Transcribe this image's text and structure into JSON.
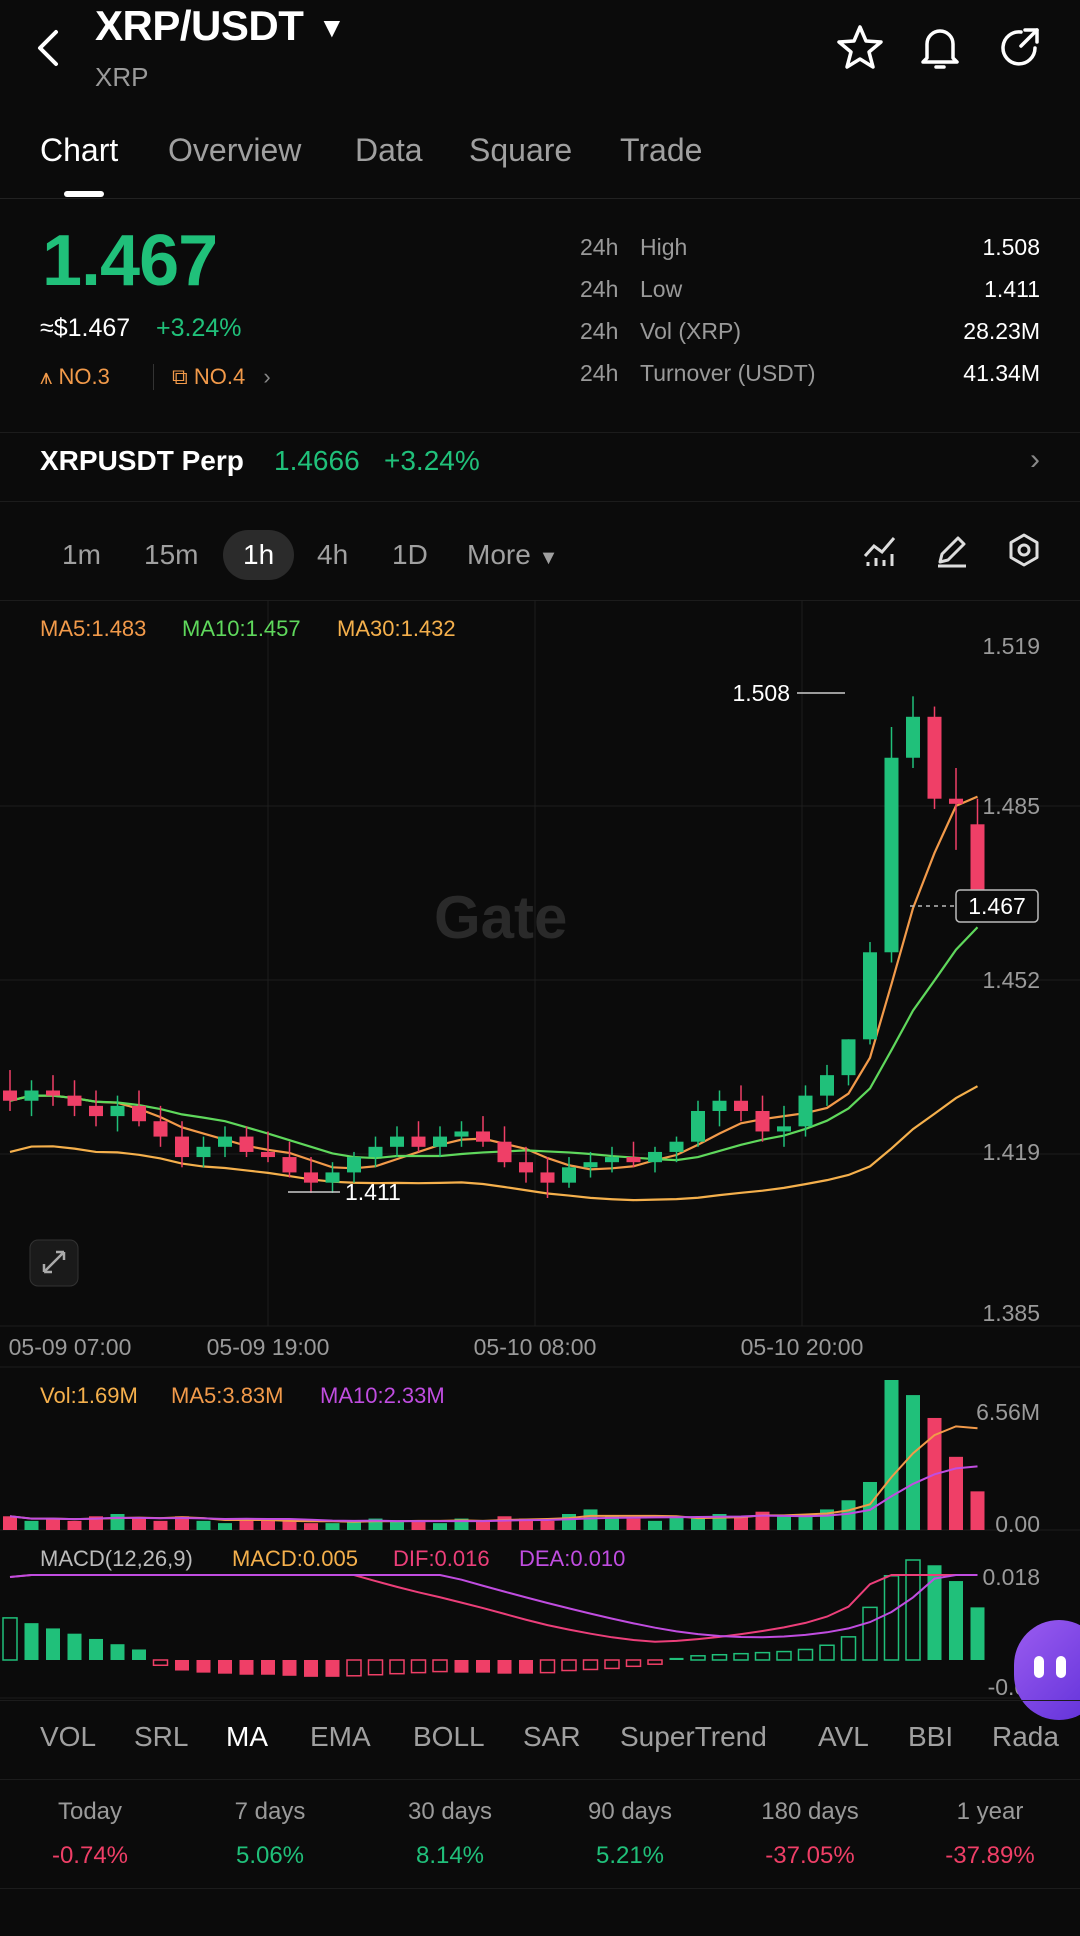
{
  "header": {
    "title": "XRP/USDT",
    "subtitle": "XRP"
  },
  "tabs": [
    {
      "label": "Chart",
      "active": true
    },
    {
      "label": "Overview"
    },
    {
      "label": "Data"
    },
    {
      "label": "Square"
    },
    {
      "label": "Trade"
    }
  ],
  "price": {
    "last": "1.467",
    "usd": "≈$1.467",
    "change": "+3.24%",
    "rank1": "NO.3",
    "rank2": "NO.4"
  },
  "stats": [
    {
      "prefix": "24h",
      "label": "High",
      "value": "1.508"
    },
    {
      "prefix": "24h",
      "label": "Low",
      "value": "1.411"
    },
    {
      "prefix": "24h",
      "label": "Vol (XRP)",
      "value": "28.23M"
    },
    {
      "prefix": "24h",
      "label": "Turnover (USDT)",
      "value": "41.34M"
    }
  ],
  "perp": {
    "name": "XRPUSDT Perp",
    "price": "1.4666",
    "change": "+3.24%"
  },
  "intervals": [
    {
      "label": "1m"
    },
    {
      "label": "15m"
    },
    {
      "label": "1h",
      "active": true
    },
    {
      "label": "4h"
    },
    {
      "label": "1D"
    },
    {
      "label": "More"
    }
  ],
  "chart": {
    "ma5": "MA5:1.483",
    "ma10": "MA10:1.457",
    "ma30": "MA30:1.432",
    "y_ticks": [
      "1.519",
      "1.485",
      "1.452",
      "1.419",
      "1.385"
    ],
    "x_ticks": [
      "05-09 07:00",
      "05-09 19:00",
      "05-10 08:00",
      "05-10 20:00"
    ],
    "high_marker": "1.508",
    "low_marker": "1.411",
    "current_marker": "1.467",
    "watermark": "Gate"
  },
  "volume": {
    "vol": "Vol:1.69M",
    "ma5": "MA5:3.83M",
    "ma10": "MA10:2.33M",
    "y_top": "6.56M",
    "y_bottom": "0.00"
  },
  "macd": {
    "label": "MACD(12,26,9)",
    "macd": "MACD:0.005",
    "dif": "DIF:0.016",
    "dea": "DEA:0.010",
    "y_top": "0.018",
    "y_bottom": "-0.00"
  },
  "indicators": [
    {
      "label": "VOL"
    },
    {
      "label": "SRL"
    },
    {
      "label": "MA",
      "active": true
    },
    {
      "label": "EMA"
    },
    {
      "label": "BOLL"
    },
    {
      "label": "SAR"
    },
    {
      "label": "SuperTrend"
    },
    {
      "label": "AVL"
    },
    {
      "label": "BBI"
    },
    {
      "label": "Rada"
    }
  ],
  "performance": [
    {
      "label": "Today",
      "value": "-0.74%",
      "dir": "down"
    },
    {
      "label": "7 days",
      "value": "5.06%",
      "dir": "up"
    },
    {
      "label": "30 days",
      "value": "8.14%",
      "dir": "up"
    },
    {
      "label": "90 days",
      "value": "5.21%",
      "dir": "up"
    },
    {
      "label": "180 days",
      "value": "-37.05%",
      "dir": "down"
    },
    {
      "label": "1 year",
      "value": "-37.89%",
      "dir": "down"
    }
  ],
  "colors": {
    "up": "#20c07a",
    "down": "#ef3f67",
    "ma5": "#f29a4a",
    "ma10": "#5fd85c",
    "ma30": "#f5b04c"
  },
  "chart_data": {
    "type": "candlestick",
    "interval": "1h",
    "ylim": [
      1.385,
      1.519
    ],
    "candles_ohlc": [
      [
        1.431,
        1.435,
        1.427,
        1.429
      ],
      [
        1.429,
        1.433,
        1.426,
        1.431
      ],
      [
        1.431,
        1.434,
        1.428,
        1.43
      ],
      [
        1.43,
        1.433,
        1.426,
        1.428
      ],
      [
        1.428,
        1.431,
        1.424,
        1.426
      ],
      [
        1.426,
        1.43,
        1.423,
        1.428
      ],
      [
        1.428,
        1.431,
        1.424,
        1.425
      ],
      [
        1.425,
        1.428,
        1.42,
        1.422
      ],
      [
        1.422,
        1.425,
        1.416,
        1.418
      ],
      [
        1.418,
        1.422,
        1.416,
        1.42
      ],
      [
        1.42,
        1.424,
        1.418,
        1.422
      ],
      [
        1.422,
        1.424,
        1.418,
        1.419
      ],
      [
        1.419,
        1.423,
        1.417,
        1.418
      ],
      [
        1.418,
        1.421,
        1.414,
        1.415
      ],
      [
        1.415,
        1.418,
        1.411,
        1.413
      ],
      [
        1.413,
        1.417,
        1.411,
        1.415
      ],
      [
        1.415,
        1.419,
        1.413,
        1.418
      ],
      [
        1.418,
        1.422,
        1.416,
        1.42
      ],
      [
        1.42,
        1.424,
        1.418,
        1.422
      ],
      [
        1.422,
        1.425,
        1.419,
        1.42
      ],
      [
        1.42,
        1.424,
        1.418,
        1.422
      ],
      [
        1.422,
        1.425,
        1.42,
        1.423
      ],
      [
        1.423,
        1.426,
        1.42,
        1.421
      ],
      [
        1.421,
        1.424,
        1.416,
        1.417
      ],
      [
        1.417,
        1.42,
        1.413,
        1.415
      ],
      [
        1.415,
        1.418,
        1.41,
        1.413
      ],
      [
        1.413,
        1.418,
        1.412,
        1.416
      ],
      [
        1.416,
        1.419,
        1.414,
        1.417
      ],
      [
        1.417,
        1.42,
        1.415,
        1.418
      ],
      [
        1.418,
        1.421,
        1.416,
        1.417
      ],
      [
        1.417,
        1.42,
        1.415,
        1.419
      ],
      [
        1.419,
        1.422,
        1.417,
        1.421
      ],
      [
        1.421,
        1.429,
        1.42,
        1.427
      ],
      [
        1.427,
        1.431,
        1.424,
        1.429
      ],
      [
        1.429,
        1.432,
        1.425,
        1.427
      ],
      [
        1.427,
        1.43,
        1.421,
        1.423
      ],
      [
        1.423,
        1.428,
        1.42,
        1.424
      ],
      [
        1.424,
        1.432,
        1.422,
        1.43
      ],
      [
        1.43,
        1.436,
        1.428,
        1.434
      ],
      [
        1.434,
        1.441,
        1.432,
        1.441
      ],
      [
        1.441,
        1.46,
        1.44,
        1.458
      ],
      [
        1.458,
        1.502,
        1.456,
        1.496
      ],
      [
        1.496,
        1.508,
        1.494,
        1.504
      ],
      [
        1.504,
        1.506,
        1.486,
        1.488
      ],
      [
        1.488,
        1.494,
        1.478,
        1.487
      ],
      [
        1.483,
        1.488,
        1.465,
        1.467
      ]
    ],
    "ma5_end": 1.483,
    "ma10_end": 1.457,
    "ma30_end": 1.432,
    "volume_m": [
      0.6,
      0.4,
      0.5,
      0.4,
      0.6,
      0.7,
      0.5,
      0.4,
      0.6,
      0.4,
      0.3,
      0.5,
      0.4,
      0.4,
      0.3,
      0.3,
      0.4,
      0.5,
      0.4,
      0.4,
      0.3,
      0.5,
      0.4,
      0.6,
      0.5,
      0.4,
      0.7,
      0.9,
      0.6,
      0.5,
      0.4,
      0.6,
      0.5,
      0.7,
      0.6,
      0.8,
      0.6,
      0.7,
      0.9,
      1.3,
      2.1,
      6.56,
      5.9,
      4.9,
      3.2,
      1.69
    ],
    "macd_hist": [
      0.004,
      0.0035,
      0.003,
      0.0025,
      0.002,
      0.0015,
      0.001,
      -0.0005,
      -0.001,
      -0.0012,
      -0.0013,
      -0.0014,
      -0.0014,
      -0.0015,
      -0.0016,
      -0.0016,
      -0.0015,
      -0.0014,
      -0.0013,
      -0.0012,
      -0.0011,
      -0.0012,
      -0.0012,
      -0.0013,
      -0.0013,
      -0.0012,
      -0.001,
      -0.0009,
      -0.0008,
      -0.0006,
      -0.0004,
      0.0002,
      0.0004,
      0.0005,
      0.0006,
      0.0007,
      0.0008,
      0.001,
      0.0014,
      0.0022,
      0.005,
      0.008,
      0.0095,
      0.009,
      0.0075,
      0.005
    ]
  }
}
